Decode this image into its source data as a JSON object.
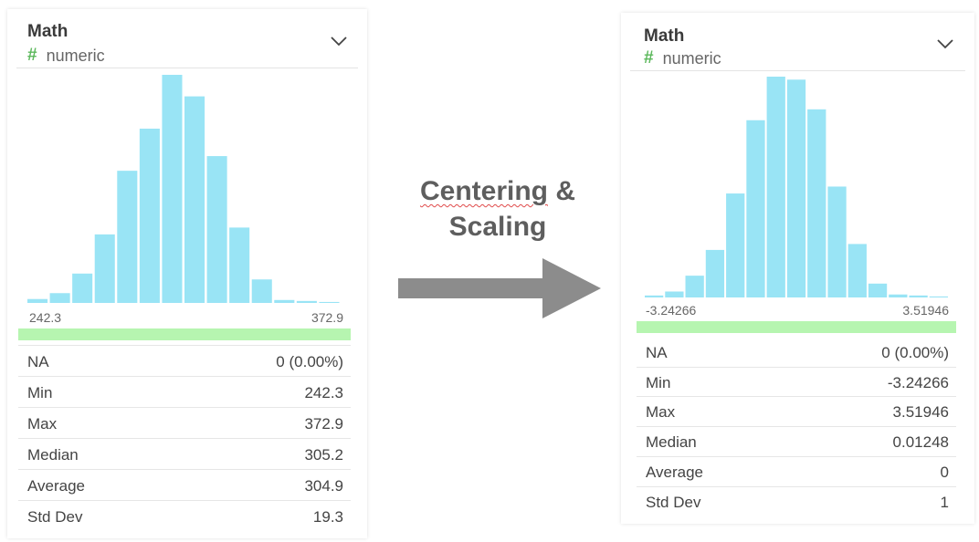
{
  "left_card": {
    "column_name": "Math",
    "type_symbol": "#",
    "type_label": "numeric",
    "chart_data": {
      "type": "bar",
      "values": [
        4,
        10,
        30,
        70,
        135,
        178,
        233,
        211,
        150,
        77,
        24,
        3,
        2,
        1
      ],
      "min_label": "242.3",
      "max_label": "372.9"
    },
    "stats": [
      {
        "label": "NA",
        "value": "0 (0.00%)"
      },
      {
        "label": "Min",
        "value": "242.3"
      },
      {
        "label": "Max",
        "value": "372.9"
      },
      {
        "label": "Median",
        "value": "305.2"
      },
      {
        "label": "Average",
        "value": "304.9"
      },
      {
        "label": "Std Dev",
        "value": "19.3"
      }
    ]
  },
  "right_card": {
    "column_name": "Math",
    "type_symbol": "#",
    "type_label": "numeric",
    "chart_data": {
      "type": "bar",
      "values": [
        2,
        6,
        22,
        48,
        105,
        179,
        223,
        220,
        190,
        112,
        54,
        14,
        3,
        2,
        1
      ],
      "min_label": "-3.24266",
      "max_label": "3.51946"
    },
    "stats": [
      {
        "label": "NA",
        "value": "0 (0.00%)"
      },
      {
        "label": "Min",
        "value": "-3.24266"
      },
      {
        "label": "Max",
        "value": "3.51946"
      },
      {
        "label": "Median",
        "value": "0.01248"
      },
      {
        "label": "Average",
        "value": "0"
      },
      {
        "label": "Std Dev",
        "value": "1"
      }
    ]
  },
  "transform": {
    "word1": "Centering",
    "word2": "&",
    "word3": "Scaling"
  },
  "colors": {
    "bar": "#99e4f5",
    "quantile_bar": "#b6f5b0",
    "arrow": "#8c8c8c",
    "type_symbol": "#5cb85c"
  }
}
